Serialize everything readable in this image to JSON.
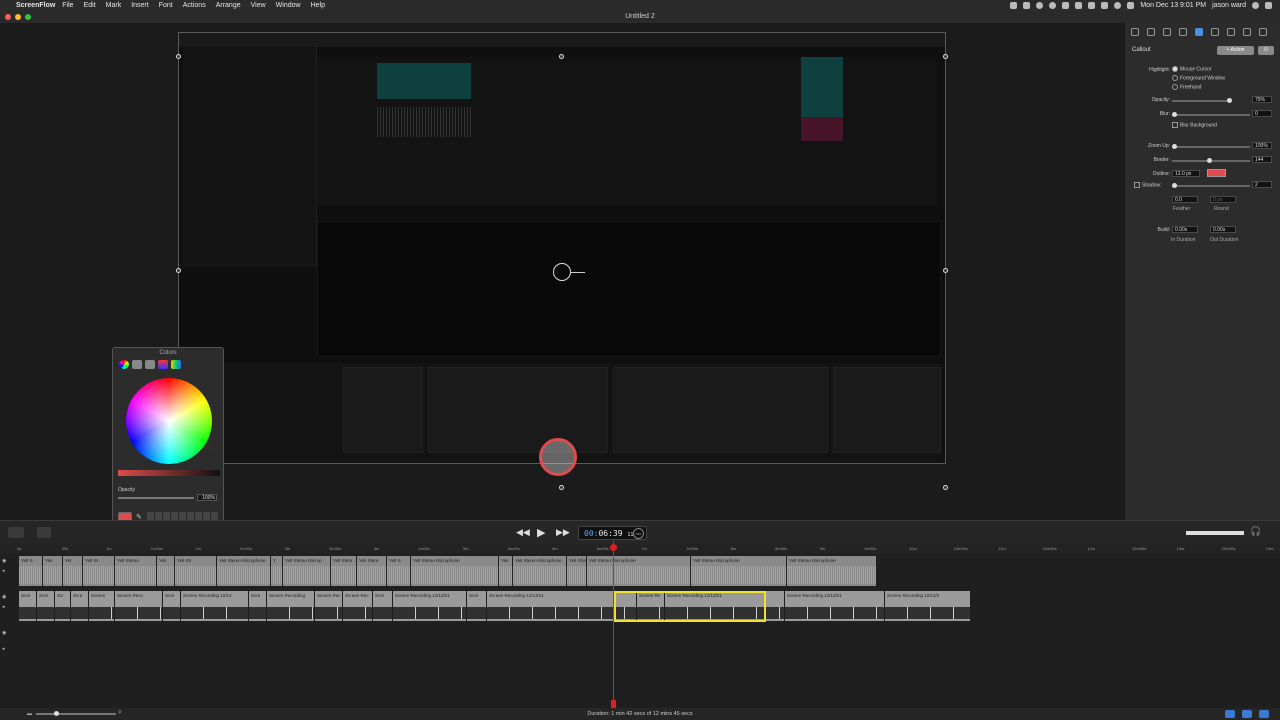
{
  "menubar": {
    "app": "ScreenFlow",
    "items": [
      "File",
      "Edit",
      "Mark",
      "Insert",
      "Font",
      "Actions",
      "Arrange",
      "View",
      "Window",
      "Help"
    ],
    "clock": "Mon Dec 13  9:01 PM",
    "user": "jason ward"
  },
  "window": {
    "title": "Untitled 2"
  },
  "colors_panel": {
    "title": "Colors",
    "opacity_label": "Opacity",
    "opacity_value": "100%",
    "selected_color": "#e04b4b"
  },
  "inspector": {
    "section": "Callout",
    "action_label": "+ Action",
    "gear_label": "⚙",
    "highlight_label": "Highlight:",
    "highlight_options": [
      "Mouse Cursor",
      "Foreground Window",
      "Freehand"
    ],
    "opacity_label": "Opacity:",
    "opacity_value": "75%",
    "opacity_level": 0.75,
    "blur_label": "Blur:",
    "blur_value": "0",
    "blur_background": "Blur Background",
    "zoom_label": "Zoom Up:",
    "zoom_value": "100%",
    "border_label": "Border:",
    "border_value": "144",
    "outline_label": "Outline:",
    "outline_value": "13.0 px",
    "outline_color": "#e04b4b",
    "shadow_label": "Shadow:",
    "shadow_value": "2",
    "feather_value": "0.0",
    "round_value": "0 px",
    "feather_label": "Feather",
    "round_label": "Round",
    "build_label": "Build:",
    "in_value": "0.00s",
    "out_value": "0.00s",
    "in_label": "In Duration",
    "out_label": "Out Duration"
  },
  "transport": {
    "timecode_prefix": "00:",
    "timecode": "06:39",
    "timecode_frames": "11",
    "zoom_pct": "69%"
  },
  "ruler": [
    "0s",
    "30s",
    "1m",
    "1m30s",
    "2m",
    "2m30s",
    "3m",
    "3m30s",
    "4m",
    "4m30s",
    "5m",
    "5m30s",
    "6m",
    "6m30s",
    "7m",
    "7m30s",
    "8m",
    "8m30s",
    "9m",
    "9m30s",
    "10m",
    "10m30s",
    "11m",
    "11m30s",
    "12m",
    "12m30s",
    "13m",
    "13m30s",
    "14m"
  ],
  "timeline": {
    "audio_clips": [
      {
        "label": "Yeti S"
      },
      {
        "label": "Yeti"
      },
      {
        "label": "Yet"
      },
      {
        "label": "Yeti St"
      },
      {
        "label": "Yeti Stereo"
      },
      {
        "label": "Yeti"
      },
      {
        "label": "Yeti Str"
      },
      {
        "label": "Yeti Stereo Microphone"
      },
      {
        "label": "Y"
      },
      {
        "label": "Yeti Stereo Microp"
      },
      {
        "label": "Yeti Stere"
      },
      {
        "label": "Yeti Stere"
      },
      {
        "label": "Yeti S"
      },
      {
        "label": "Yeti Stereo Microphone"
      },
      {
        "label": "Yeti"
      },
      {
        "label": "Yeti Stereo Microphone"
      },
      {
        "label": "Yeti Shar"
      },
      {
        "label": "Yeti Stereo Microphone"
      },
      {
        "label": "Yeti Stereo Microphone"
      },
      {
        "label": "Yeti Stereo Microphone"
      }
    ],
    "video_clips": [
      {
        "label": "Scre"
      },
      {
        "label": "Scre"
      },
      {
        "label": "Scr"
      },
      {
        "label": "Scre"
      },
      {
        "label": "Screen"
      },
      {
        "label": "Screen Reco"
      },
      {
        "label": "Scre"
      },
      {
        "label": "Screen Recording 12/13"
      },
      {
        "label": "Scre"
      },
      {
        "label": "Screen Recording"
      },
      {
        "label": "Screen Rec"
      },
      {
        "label": "Screen Rec"
      },
      {
        "label": "Scre"
      },
      {
        "label": "Screen Recording 12/13/21"
      },
      {
        "label": "Scre"
      },
      {
        "label": "Screen Recording 12/13/21"
      },
      {
        "label": "Screen Re"
      },
      {
        "label": "Screen Recording 12/13/21"
      },
      {
        "label": "Screen Recording 12/13/21"
      },
      {
        "label": "Screen Recording 12/13/2"
      }
    ]
  },
  "status": {
    "duration": "Duration: 1 min 42 secs of 12 mins 45 secs"
  }
}
